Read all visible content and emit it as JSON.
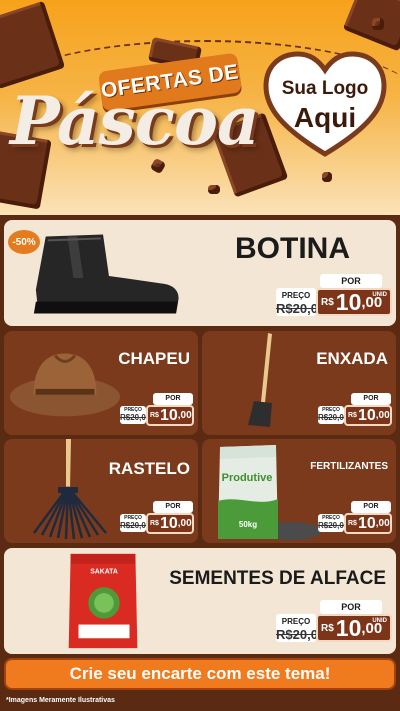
{
  "header": {
    "banner": "OFERTAS DE",
    "title": "Páscoa",
    "logo_line1": "Sua Logo",
    "logo_line2": "Aqui"
  },
  "products": [
    {
      "name": "BOTINA",
      "discount": "-50%",
      "preco_label": "PREÇO",
      "old_price": "R$20,00",
      "por_label": "POR",
      "currency": "R$",
      "price_int": "10",
      "price_cents": ",00",
      "unit": "UNID"
    },
    {
      "name": "CHAPEU",
      "preco_label": "PREÇO",
      "old_price": "R$20,00",
      "por_label": "POR",
      "currency": "R$",
      "price_int": "10",
      "price_cents": ",00"
    },
    {
      "name": "ENXADA",
      "preco_label": "PREÇO",
      "old_price": "R$20,00",
      "por_label": "POR",
      "currency": "R$",
      "price_int": "10",
      "price_cents": ",00"
    },
    {
      "name": "RASTELO",
      "preco_label": "PREÇO",
      "old_price": "R$20,00",
      "por_label": "POR",
      "currency": "R$",
      "price_int": "10",
      "price_cents": ",00"
    },
    {
      "name": "FERTILIZANTES",
      "preco_label": "PREÇO",
      "old_price": "R$20,00",
      "por_label": "POR",
      "currency": "R$",
      "price_int": "10",
      "price_cents": ",00",
      "bag_brand": "Produtive",
      "bag_weight": "50kg"
    },
    {
      "name": "SEMENTES DE ALFACE",
      "preco_label": "PREÇO",
      "old_price": "R$20,00",
      "por_label": "POR",
      "currency": "R$",
      "price_int": "10",
      "price_cents": ",00",
      "unit": "UNID",
      "pack_brand": "SAKATA"
    }
  ],
  "cta": "Crie seu encarte com este tema!",
  "disclaimer": "*Imagens Meramente Ilustrativas"
}
